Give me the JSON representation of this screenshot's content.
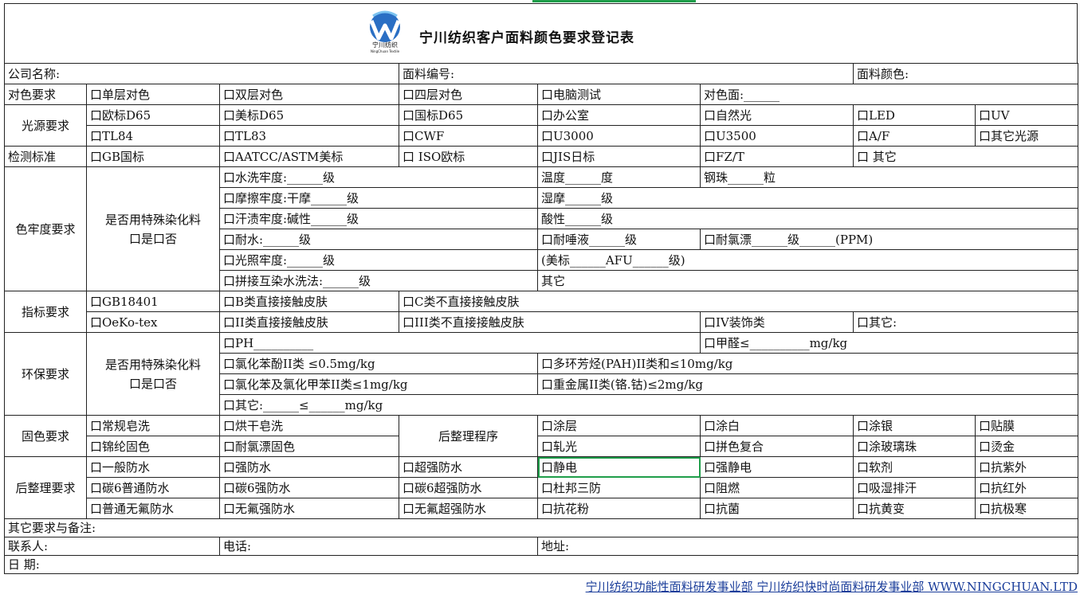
{
  "title": "宁川纺织客户面料颜色要求登记表",
  "logo_text": "宁川纺织",
  "logo_sub": "NingChuan Textile",
  "rows": {
    "company": "公司名称:",
    "fabric_no": "面料编号:",
    "fabric_color": "面料颜色:",
    "match_req": "对色要求",
    "match_1": "口单层对色",
    "match_2": "口双层对色",
    "match_3": "口四层对色",
    "match_4": "口电脑测试",
    "match_face": "对色面:______",
    "light_req": "光源要求",
    "light_1": "口欧标D65",
    "light_2": "口美标D65",
    "light_3": "口国标D65",
    "light_4": "口办公室",
    "light_5": "口自然光",
    "light_6": "口LED",
    "light_7": "口UV",
    "light_8": "口TL84",
    "light_9": "口TL83",
    "light_10": "口CWF",
    "light_11": "口U3000",
    "light_12": "口U3500",
    "light_13": "口A/F",
    "light_14": "口其它光源",
    "test_std": "检测标准",
    "std_1": "口GB国标",
    "std_2": "口AATCC/ASTM美标",
    "std_3": "口 ISO欧标",
    "std_4": "口JIS日标",
    "std_5": "口FZ/T",
    "std_6": "口 其它",
    "fast_req": "色牢度要求",
    "special_dye": "是否用特殊染化料",
    "yes_no_1": "口是口否",
    "fast_1": "口水洗牢度:______级",
    "fast_temp": "温度______度",
    "fast_ball": "钢珠______粒",
    "fast_2": "口摩擦牢度:干摩______级",
    "fast_wet": "湿摩______级",
    "fast_3": "口汗渍牢度:碱性______级",
    "fast_acid": "酸性______级",
    "fast_4": "口耐水:______级",
    "fast_saliva": "口耐唾液______级",
    "fast_chlorine": "口耐氯漂______级______(PPM)",
    "fast_5": "口光照牢度:______级",
    "fast_afu": "(美标______AFU______级)",
    "fast_6": "口拼接互染水洗法:______级",
    "fast_other": "其它",
    "index_req": "指标要求",
    "idx_1": "口GB18401",
    "idx_2": "口B类直接接触皮肤",
    "idx_3": "口C类不直接接触皮肤",
    "idx_4": "口OeKo-tex",
    "idx_5": "口II类直接接触皮肤",
    "idx_6": "口III类不直接接触皮肤",
    "idx_7": "口IV装饰类",
    "idx_8": "口其它:",
    "env_req": "环保要求",
    "yes_no_2": "口是口否",
    "env_1": "口PH__________",
    "env_2": "口甲醛≤__________mg/kg",
    "env_3": "口氯化苯酚II类 ≤0.5mg/kg",
    "env_4": "口多环芳烃(PAH)II类和≤10mg/kg",
    "env_5": "口氯化苯及氯化甲苯II类≤1mg/kg",
    "env_6": "口重金属II类(铬.钴)≤2mg/kg",
    "env_7": "口其它:______≤______mg/kg",
    "fix_req": "固色要求",
    "fix_1": "口常规皂洗",
    "fix_2": "口烘干皂洗",
    "fix_3": "口锦纶固色",
    "fix_4": "口耐氯漂固色",
    "finish_proc": "后整理程序",
    "fp_1": "口涂层",
    "fp_2": "口涂白",
    "fp_3": "口涂银",
    "fp_4": "口贴膜",
    "fp_5": "口轧光",
    "fp_6": "口拼色复合",
    "fp_7": "口涂玻璃珠",
    "fp_8": "口烫金",
    "finish_req": "后整理要求",
    "fr_1": "口一般防水",
    "fr_2": "口强防水",
    "fr_3": "口超强防水",
    "fr_4": "口静电",
    "fr_5": "口强静电",
    "fr_6": "口软剂",
    "fr_7": "口抗紫外",
    "fr_8": "口碳6普通防水",
    "fr_9": "口碳6强防水",
    "fr_10": "口碳6超强防水",
    "fr_11": "口杜邦三防",
    "fr_12": "口阻燃",
    "fr_13": "口吸湿排汗",
    "fr_14": "口抗红外",
    "fr_15": "口普通无氟防水",
    "fr_16": "口无氟强防水",
    "fr_17": "口无氟超强防水",
    "fr_18": "口抗花粉",
    "fr_19": "口抗菌",
    "fr_20": "口抗黄变",
    "fr_21": "口抗极寒",
    "remarks": "其它要求与备注:",
    "contact": "联系人:",
    "phone": "电话:",
    "address": "地址:",
    "date": "日   期:"
  },
  "footer": "宁川纺织功能性面料研发事业部   宁川纺织快时尚面料研发事业部  WWW.NINGCHUAN.LTD",
  "colors": {
    "accent": "#1f9e4a",
    "logo_blue": "#1a73c8",
    "link": "#1a3d9a"
  }
}
